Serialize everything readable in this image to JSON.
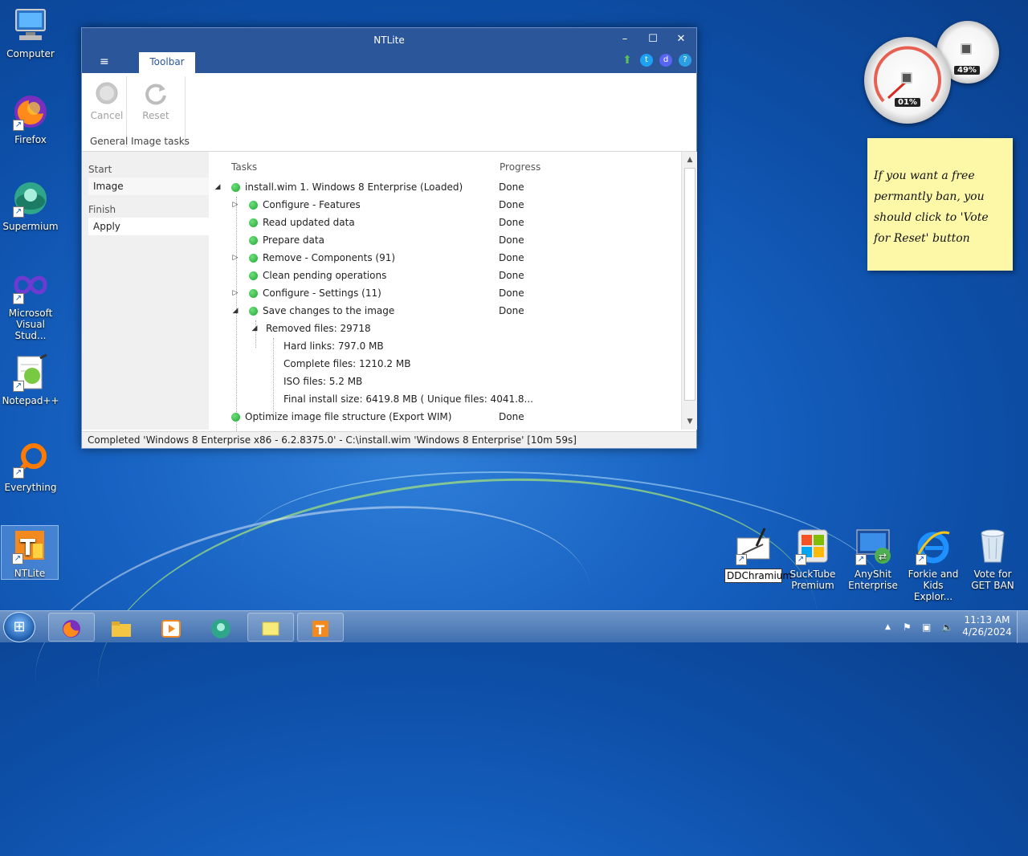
{
  "window": {
    "title": "NTLite",
    "controls": {
      "minimize": "–",
      "maximize": "☐",
      "close": "✕"
    },
    "menu_icon": "≡",
    "tab": "Toolbar"
  },
  "ribbon": {
    "cancel": "Cancel",
    "reset": "Reset",
    "group_general": "General",
    "group_image_tasks": "Image tasks"
  },
  "nav": {
    "start_header": "Start",
    "image": "Image",
    "finish_header": "Finish",
    "apply": "Apply"
  },
  "tasks": {
    "col_tasks": "Tasks",
    "col_progress": "Progress",
    "rows": [
      {
        "label": "install.wim 1. Windows 8 Enterprise  (Loaded)",
        "progress": "Done"
      },
      {
        "label": "Configure - Features",
        "progress": "Done"
      },
      {
        "label": "Read updated data",
        "progress": "Done"
      },
      {
        "label": "Prepare data",
        "progress": "Done"
      },
      {
        "label": "Remove - Components (91)",
        "progress": "Done"
      },
      {
        "label": "Clean pending operations",
        "progress": "Done"
      },
      {
        "label": "Configure - Settings (11)",
        "progress": "Done"
      },
      {
        "label": "Save changes to the image",
        "progress": "Done"
      },
      {
        "label": "Removed files: 29718",
        "progress": ""
      },
      {
        "label": "Hard links: 797.0 MB",
        "progress": ""
      },
      {
        "label": "Complete files: 1210.2 MB",
        "progress": ""
      },
      {
        "label": "ISO files: 5.2 MB",
        "progress": ""
      },
      {
        "label": "Final install size: 6419.8 MB ( Unique files: 4041.8...",
        "progress": ""
      },
      {
        "label": "Optimize image file structure (Export WIM)",
        "progress": "Done"
      }
    ]
  },
  "status": "Completed  'Windows 8 Enterprise x86 - 6.2.8375.0' - C:\\install.wim 'Windows 8 Enterprise' [10m 59s]",
  "gadgets": {
    "cpu_percent": "01%",
    "memory_percent": "49%"
  },
  "sticky_note": "If you want a free permantly ban, you should click to 'Vote for Reset' button",
  "desktop_icons": {
    "computer": "Computer",
    "firefox": "Firefox",
    "supermium": "Supermium",
    "vs": "Microsoft Visual Stud...",
    "notepadpp": "Notepad++",
    "everything": "Everything",
    "ntlite": "NTLite",
    "ddchramium": "DDChramium",
    "sucktube": "SuckTube Premium",
    "anyshit": "AnyShit Enterprise",
    "forkie": "Forkie and Kids Explor...",
    "vote": "Vote for GET BAN"
  },
  "clock": {
    "time": "11:13 AM",
    "date": "4/26/2024"
  },
  "colors": {
    "titlebar": "#2b579a",
    "done_dot": "#1ea635",
    "sticky": "#fcf8a8"
  }
}
